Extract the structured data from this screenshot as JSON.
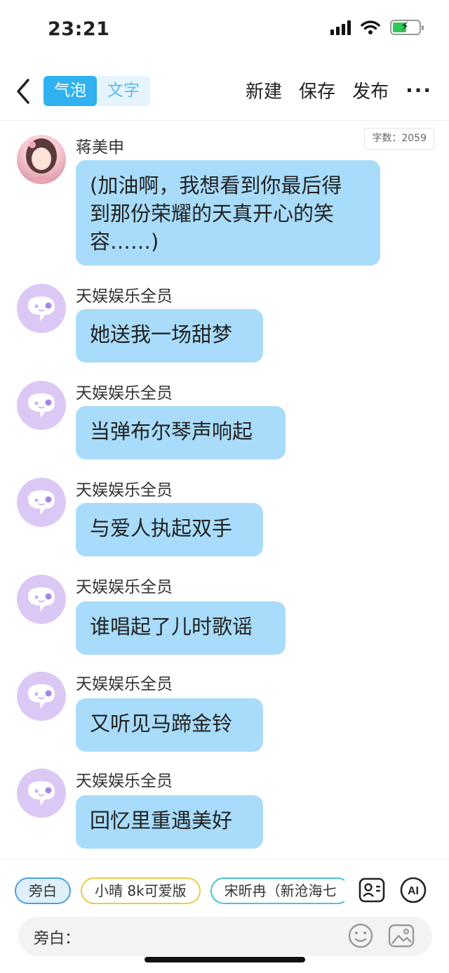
{
  "status": {
    "time": "23:21"
  },
  "header": {
    "tabs": [
      "气泡",
      "文字"
    ],
    "new_label": "新建",
    "save_label": "保存",
    "publish_label": "发布",
    "more_label": "···"
  },
  "word_count": "字数：2059",
  "messages": [
    {
      "sender": "蒋美申",
      "avatar": "photo",
      "lines": [
        "(加油啊，我想看到你最后得",
        "到那份荣耀的天真开心的笑",
        "容……)"
      ]
    },
    {
      "sender": "天娱娱乐全员",
      "avatar": "ghost",
      "lines": [
        "她送我一场甜梦"
      ]
    },
    {
      "sender": "天娱娱乐全员",
      "avatar": "ghost",
      "lines": [
        "当弹布尔琴声响起"
      ]
    },
    {
      "sender": "天娱娱乐全员",
      "avatar": "ghost",
      "lines": [
        "与爱人执起双手"
      ]
    },
    {
      "sender": "天娱娱乐全员",
      "avatar": "ghost",
      "lines": [
        "谁唱起了儿时歌谣"
      ]
    },
    {
      "sender": "天娱娱乐全员",
      "avatar": "ghost",
      "lines": [
        "又听见马蹄金铃"
      ]
    },
    {
      "sender": "天娱娱乐全员",
      "avatar": "ghost",
      "lines": [
        "回忆里重遇美好"
      ]
    }
  ],
  "bottom": {
    "chips": [
      "旁白",
      "小晴 8k可爱版",
      "宋昕冉（新沧海七"
    ],
    "input_label": "旁白：",
    "tools": [
      "contacts-icon",
      "ai-icon",
      "emoji-icon",
      "image-icon"
    ]
  }
}
